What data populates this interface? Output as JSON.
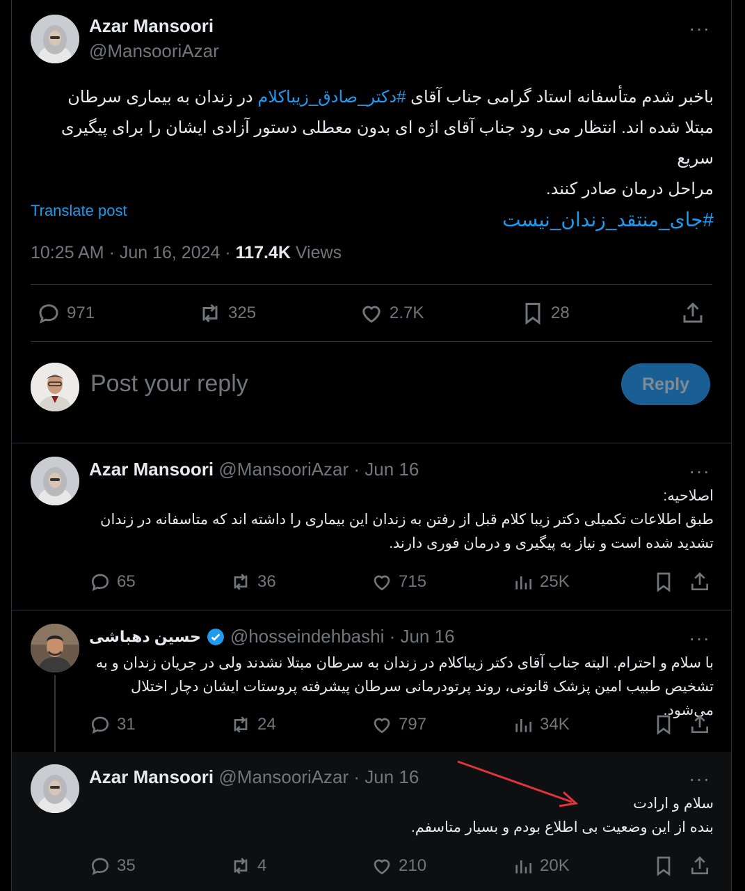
{
  "main_post": {
    "author_name": "Azar Mansoori",
    "handle": "@MansooriAzar",
    "more": "···",
    "body": {
      "line1_pre": "باخبر شدم متأسفانه استاد گرامی جناب آقای ",
      "line1_tag": "#دکتر_صادق_زیباکلام",
      "line1_post": " در زندان به بیماری سرطان",
      "line2": "مبتلا شده اند. انتظار می رود جناب آقای اژه ای بدون معطلی دستور آزادی ایشان را  برای پیگیری سریع",
      "line3": "مراحل درمان صادر کنند.",
      "hashtag": "#جای_منتقد_زندان_نیست"
    },
    "translate": "Translate post",
    "meta_time": "10:25 AM · Jun 16, 2024 · ",
    "meta_views_count": "117.4K",
    "meta_views_label": " Views",
    "actions": {
      "replies": "971",
      "reposts": "325",
      "likes": "2.7K",
      "bookmarks": "28"
    }
  },
  "reply_box": {
    "placeholder": "Post your reply",
    "button": "Reply"
  },
  "replies": [
    {
      "author_name": "Azar Mansoori",
      "handle_date": "@MansooriAzar · Jun 16",
      "more": "···",
      "lines": [
        "اصلاحیه:",
        "طبق اطلاعات تکمیلی دکتر زیبا کلام قبل از رفتن به زندان این بیماری را داشته اند که متاسفانه در زندان",
        "تشدید شده است و نیاز به پیگیری و درمان فوری دارند."
      ],
      "actions": {
        "replies": "65",
        "reposts": "36",
        "likes": "715",
        "views": "25K"
      }
    },
    {
      "author_name": "حسین دهباشی",
      "handle_date": "@hosseindehbashi · Jun 16",
      "more": "···",
      "lines": [
        "با سلام و احترام. البته جناب آقای دکتر زیباکلام در زندان به سرطان مبتلا نشدند ولی در جریان زندان و به",
        "تشخیص طبیب امین پزشک قانونی، روند پرتودرمانی سرطان پیشرفته پروستات ایشان دچار اختلال می‌شود."
      ],
      "actions": {
        "replies": "31",
        "reposts": "24",
        "likes": "797",
        "views": "34K"
      }
    },
    {
      "author_name": "Azar Mansoori",
      "handle_date": "@MansooriAzar · Jun 16",
      "more": "···",
      "lines": [
        "سلام و ارادت",
        "بنده از این وضعیت بی اطلاع بودم و بسیار متاسفم."
      ],
      "actions": {
        "replies": "35",
        "reposts": "4",
        "likes": "210",
        "views": "20K"
      }
    }
  ],
  "colors": {
    "accent": "#1d9bf0",
    "muted": "#71767b",
    "verified": "#1d9bf0",
    "annotation_arrow": "#e0343c",
    "reply_button": "#1a5f94"
  }
}
